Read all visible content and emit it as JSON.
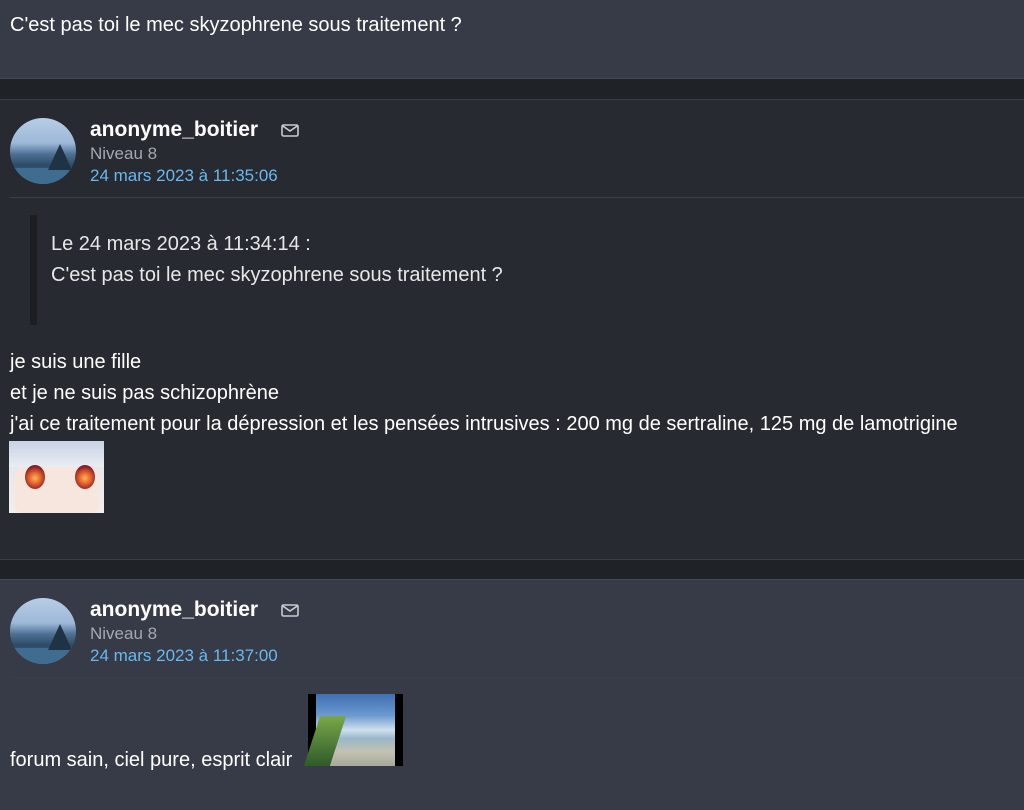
{
  "post1": {
    "text": "C'est pas toi le mec skyzophrene sous traitement ?"
  },
  "post2": {
    "author": "anonyme_boitier",
    "level": "Niveau 8",
    "date": "24 mars 2023 à 11:35:06",
    "quote": {
      "header": "Le 24 mars 2023 à 11:34:14 :",
      "text": "C'est pas toi le mec skyzophrene sous traitement ?"
    },
    "lines": [
      "je suis une fille",
      "et je ne suis pas schizophrène",
      "j'ai ce traitement pour la dépression et les pensées intrusives : 200 mg de sertraline, 125 mg de lamotrigine"
    ]
  },
  "post3": {
    "author": "anonyme_boitier",
    "level": "Niveau 8",
    "date": "24 mars 2023 à 11:37:00",
    "text": "forum sain, ciel pure, esprit clair"
  },
  "icons": {
    "message": "envelope-icon"
  },
  "colors": {
    "date_link": "#6ab8ee",
    "post_bg_light": "#363b47",
    "post_bg_dark": "#272a30"
  }
}
